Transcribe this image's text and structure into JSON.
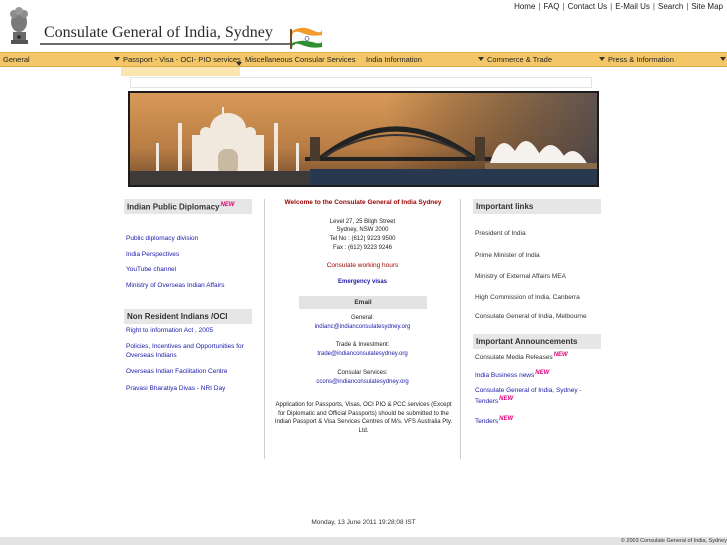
{
  "header": {
    "title": "Consulate General of India, Sydney",
    "top_links": [
      "Home",
      "FAQ",
      "Contact Us",
      "E-Mail Us",
      "Search",
      "Site Map"
    ]
  },
  "nav": [
    "General",
    "Passport - Visa - OCI- PIO services",
    "Miscellaneous Consular Services",
    "India Information",
    "Commerce & Trade",
    "Press & Information"
  ],
  "left": {
    "heading1": "Indian Public Diplomacy",
    "links1": [
      "Public diplomacy division",
      "India Perspectives",
      "YouTube channel",
      "Ministry of Overseas Indian Affairs"
    ],
    "heading2": "Non Resident Indians /OCI",
    "links2": [
      "Right to information Act , 2005",
      "Policies, Incentives and Opportunities for Overseas Indians",
      "Overseas Indian Facilitation Centre",
      "Pravasi Bharatiya Divas - NRI Day"
    ]
  },
  "center": {
    "welcome": "Welcome to the Consulate General of India Sydney",
    "address": [
      "Level 27, 25 Bligh Street",
      "Sydney, NSW 2000",
      "Tel No : (612) 9223 9500",
      "Fax : (612) 9223 9246"
    ],
    "hours": "Consulate working hours",
    "emergency": "Emergency visas",
    "email_head": "Email",
    "general_label": "General:",
    "general_email": "indianc@indianconsulatesydney.org",
    "trade_label": "Trade & Investment:",
    "trade_email": "trade@indianconsulatesydney.org",
    "consular_label": "Consular Services:",
    "consular_email": "ccons@indianconsulatesydney.org",
    "notice": "Application for Passports, Visas, OCI PIO & PCC services (Except for Diplomatic and Official Passports) should be submitted to the Indian Passport & Visa Services Centres of M/s. VFS Australia Pty. Ltd."
  },
  "right": {
    "heading1": "Important links",
    "links1": [
      "President of India",
      "Prime Minister of India",
      "Ministry of External Affairs MEA",
      "High Commission of India, Canberra",
      "Consulate General of India, Melbourne"
    ],
    "heading2": "Important Announcements",
    "links2": [
      "Consulate Media Releases",
      "India Business news",
      "Consulate General of India, Sydney - Tenders",
      "Tenders"
    ]
  },
  "new_badge": "NEW",
  "footer": {
    "date": "Monday, 13 June 2011 19:28:08 IST",
    "copyright": "© 2003 Consulate General of India, Sydney"
  }
}
